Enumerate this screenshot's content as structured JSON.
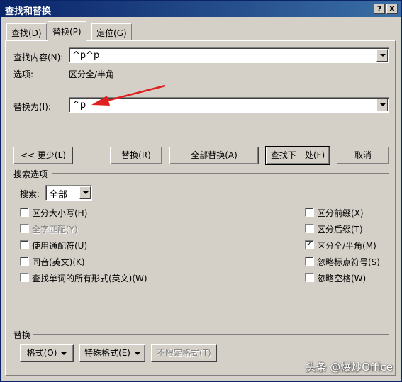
{
  "window": {
    "title": "查找和替换",
    "help_label": "?",
    "close_label": "X"
  },
  "tabs": [
    {
      "label": "查找(D)"
    },
    {
      "label": "替换(P)"
    },
    {
      "label": "定位(G)"
    }
  ],
  "find": {
    "label": "查找内容(N):",
    "value": "^p^p"
  },
  "options": {
    "label": "选项:",
    "value": "区分全/半角"
  },
  "replace": {
    "label": "替换为(I):",
    "value": "^p"
  },
  "buttons": {
    "less": "<< 更少(L)",
    "replace": "替换(R)",
    "replace_all": "全部替换(A)",
    "find_next": "查找下一处(F)",
    "cancel": "取消"
  },
  "search_options": {
    "group_label": "搜索选项",
    "search_label": "搜索:",
    "search_value": "全部",
    "left_checks": [
      {
        "label": "区分大小写(H)",
        "checked": false,
        "disabled": false
      },
      {
        "label": "全字匹配(Y)",
        "checked": false,
        "disabled": true
      },
      {
        "label": "使用通配符(U)",
        "checked": false,
        "disabled": false
      },
      {
        "label": "同音(英文)(K)",
        "checked": false,
        "disabled": false
      },
      {
        "label": "查找单词的所有形式(英文)(W)",
        "checked": false,
        "disabled": false
      }
    ],
    "right_checks": [
      {
        "label": "区分前缀(X)",
        "checked": false
      },
      {
        "label": "区分后缀(T)",
        "checked": false
      },
      {
        "label": "区分全/半角(M)",
        "checked": true
      },
      {
        "label": "忽略标点符号(S)",
        "checked": false
      },
      {
        "label": "忽略空格(W)",
        "checked": false
      }
    ]
  },
  "replace_section": {
    "group_label": "替换",
    "format_label": "格式(O)",
    "special_label": "特殊格式(E)",
    "no_format_label": "不限定格式(T)"
  },
  "annotation_color": "#e02020",
  "watermark": "头条 @爆炒Office"
}
